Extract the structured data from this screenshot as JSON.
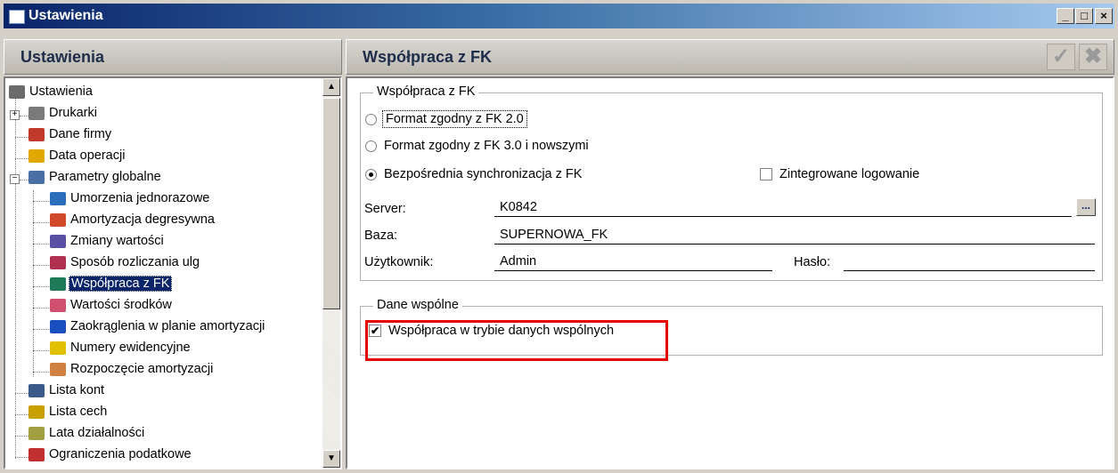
{
  "window": {
    "title": "Ustawienia",
    "controls": [
      "_",
      "□",
      "×"
    ]
  },
  "left_panel": {
    "header": "Ustawienia",
    "tree": [
      {
        "label": "Ustawienia",
        "icon": "keyboard-icon",
        "color": "#6b6b6b"
      },
      {
        "label": "Drukarki",
        "icon": "printer-icon",
        "color": "#7a7a7a"
      },
      {
        "label": "Dane firmy",
        "icon": "company-icon",
        "color": "#c0392b"
      },
      {
        "label": "Data operacji",
        "icon": "clock-icon",
        "color": "#e0a800"
      },
      {
        "label": "Parametry globalne",
        "icon": "parameters-icon",
        "color": "#4a6fa5"
      },
      {
        "label": "Umorzenia jednorazowe",
        "icon": "chart-icon",
        "color": "#2a6ebb"
      },
      {
        "label": "Amortyzacja degresywna",
        "icon": "people-icon",
        "color": "#d04a2a"
      },
      {
        "label": "Zmiany wartości",
        "icon": "calendar-icon",
        "color": "#5a4fa5"
      },
      {
        "label": "Sposób rozliczania ulg",
        "icon": "gift-icon",
        "color": "#b03050"
      },
      {
        "label": "Współpraca z FK",
        "icon": "fk-icon",
        "color": "#1f7a5a"
      },
      {
        "label": "Wartości środków",
        "icon": "money-icon",
        "color": "#d05070"
      },
      {
        "label": "Zaokrąglenia w planie amortyzacji",
        "icon": "rounding-icon",
        "color": "#1a4fc0"
      },
      {
        "label": "Numery ewidencyjne",
        "icon": "numbers-icon",
        "color": "#e0c000"
      },
      {
        "label": "Rozpoczęcie amortyzacji",
        "icon": "start-chart-icon",
        "color": "#d08040"
      },
      {
        "label": "Lista kont",
        "icon": "list-icon",
        "color": "#3a5a8a"
      },
      {
        "label": "Lista cech",
        "icon": "tag-icon",
        "color": "#c8a000"
      },
      {
        "label": "Lata działalności",
        "icon": "years-icon",
        "color": "#a0a040"
      },
      {
        "label": "Ograniczenia podatkowe",
        "icon": "tax-icon",
        "color": "#c03030"
      }
    ]
  },
  "right_panel": {
    "header": "Współpraca z FK",
    "confirm_icon": "✓",
    "cancel_icon": "✖",
    "fk_group": {
      "title": "Współpraca z FK",
      "options": [
        {
          "label": "Format zgodny z FK 2.0",
          "selected": false
        },
        {
          "label": "Format zgodny z FK 3.0 i nowszymi",
          "selected": false
        },
        {
          "label": "Bezpośrednia synchronizacja z FK",
          "selected": true
        }
      ],
      "integrated_login_label": "Zintegrowane logowanie",
      "integrated_login_checked": false,
      "server_label": "Server:",
      "server_value": "K0842",
      "browse_label": "...",
      "db_label": "Baza:",
      "db_value": "SUPERNOWA_FK",
      "user_label": "Użytkownik:",
      "user_value": "Admin",
      "password_label": "Hasło:",
      "password_value": ""
    },
    "shared_group": {
      "title": "Dane wspólne",
      "checkbox_label": "Współpraca w trybie danych wspólnych",
      "checkbox_checked": true,
      "checkmark": "✔"
    }
  },
  "colors": {
    "selection": "#0a246a",
    "highlight_border": "#e60000",
    "titlebar": "#0a246a"
  }
}
